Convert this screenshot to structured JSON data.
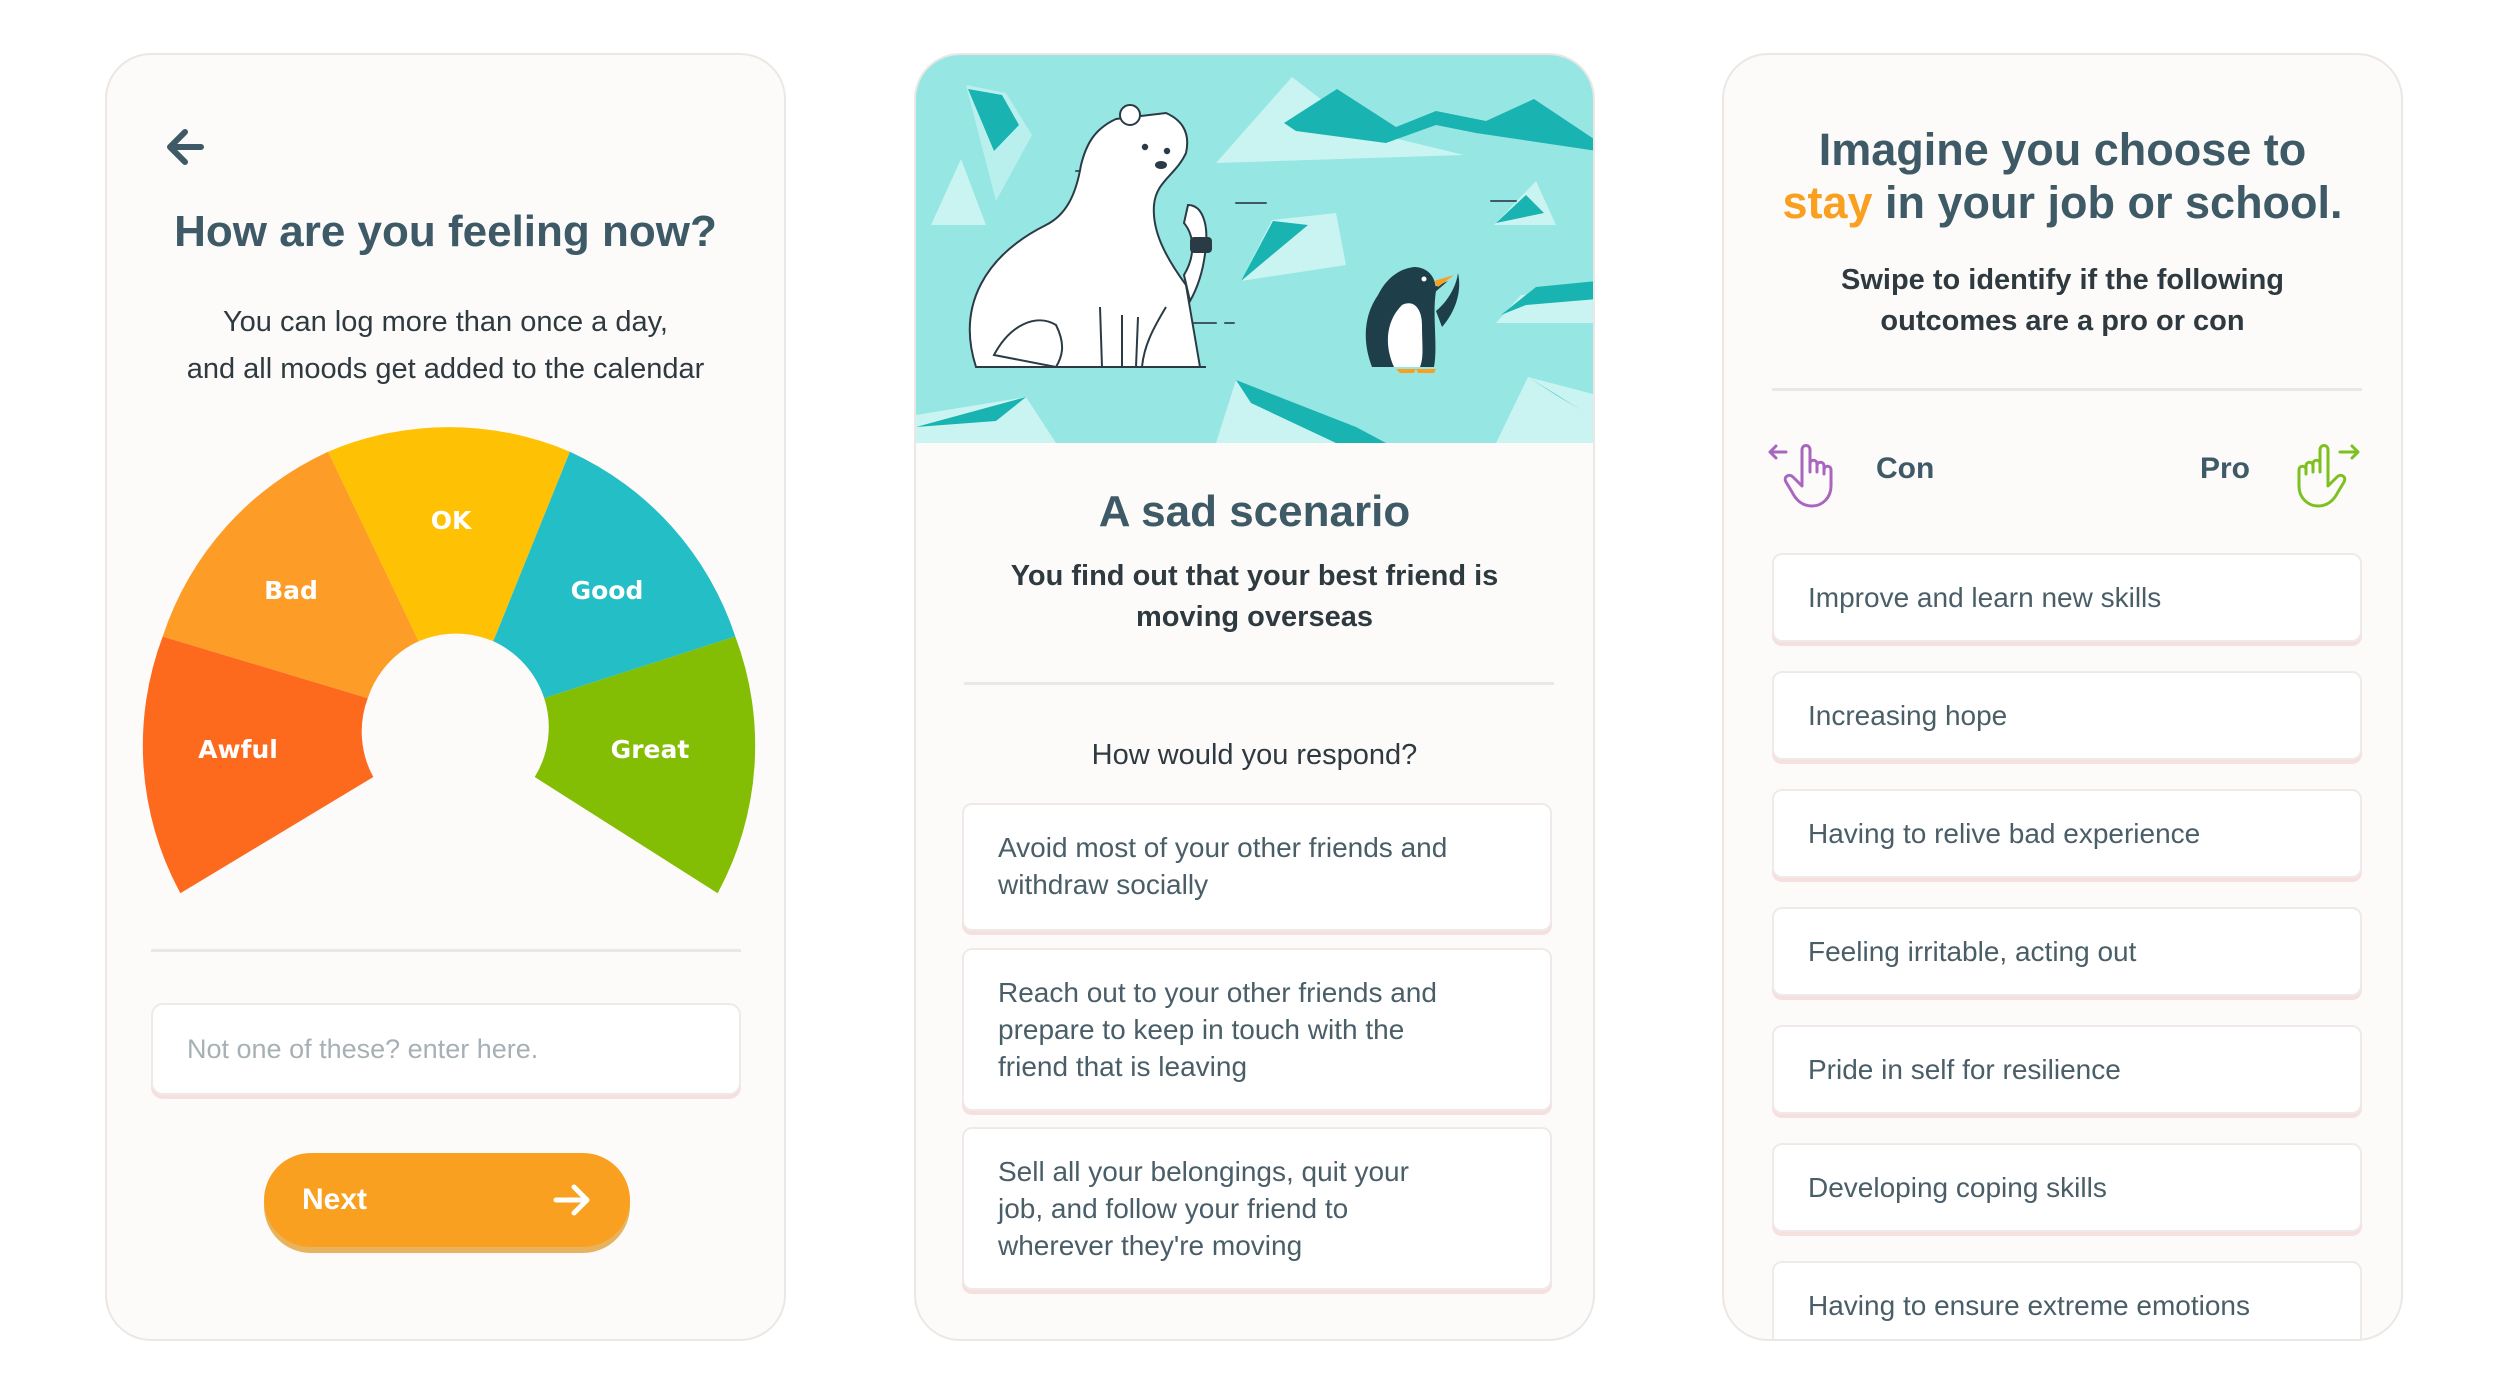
{
  "screens": {
    "mood": {
      "title": "How are you feeling now?",
      "subtitle_line1": "You can log more than once a day,",
      "subtitle_line2": "and all moods get added to the calendar",
      "moods": [
        {
          "label": "Awful",
          "color": "#fd6a1e"
        },
        {
          "label": "Bad",
          "color": "#fd9c26"
        },
        {
          "label": "OK",
          "color": "#fec104"
        },
        {
          "label": "Good",
          "color": "#23bec6"
        },
        {
          "label": "Great",
          "color": "#83bd04"
        }
      ],
      "input_placeholder": "Not one of these? enter here.",
      "next_label": "Next",
      "back_icon": "arrow-left-icon"
    },
    "scenario": {
      "title": "A sad scenario",
      "description_line1": "You find out that your best friend is",
      "description_line2": "moving overseas",
      "question": "How would you respond?",
      "options": [
        {
          "line1": "Avoid most of your other friends and",
          "line2": "withdraw socially",
          "line3": ""
        },
        {
          "line1": "Reach out to your other friends and",
          "line2": "prepare to keep in touch with the",
          "line3": "friend that is leaving"
        },
        {
          "line1": "Sell all your belongings, quit your",
          "line2": "job, and follow your friend to",
          "line3": "wherever they're moving"
        }
      ],
      "illustration": "polar-bear-and-penguin-icon"
    },
    "choices": {
      "title_line1": "Imagine you choose to",
      "title_highlight": "stay",
      "title_rest": " in your job or school.",
      "subtitle_line1": "Swipe to identify if the following",
      "subtitle_line2": "outcomes are a pro or con",
      "con_label": "Con",
      "pro_label": "Pro",
      "outcomes": [
        "Improve and learn new skills",
        "Increasing hope",
        "Having to relive bad experience",
        "Feeling irritable, acting out",
        "Pride in self for resilience",
        "Developing coping skills",
        "Having to ensure extreme emotions"
      ],
      "colors": {
        "accent": "#f9a020",
        "con": "#a966c0",
        "pro": "#7cc120",
        "heading": "#3d5a66"
      }
    }
  }
}
